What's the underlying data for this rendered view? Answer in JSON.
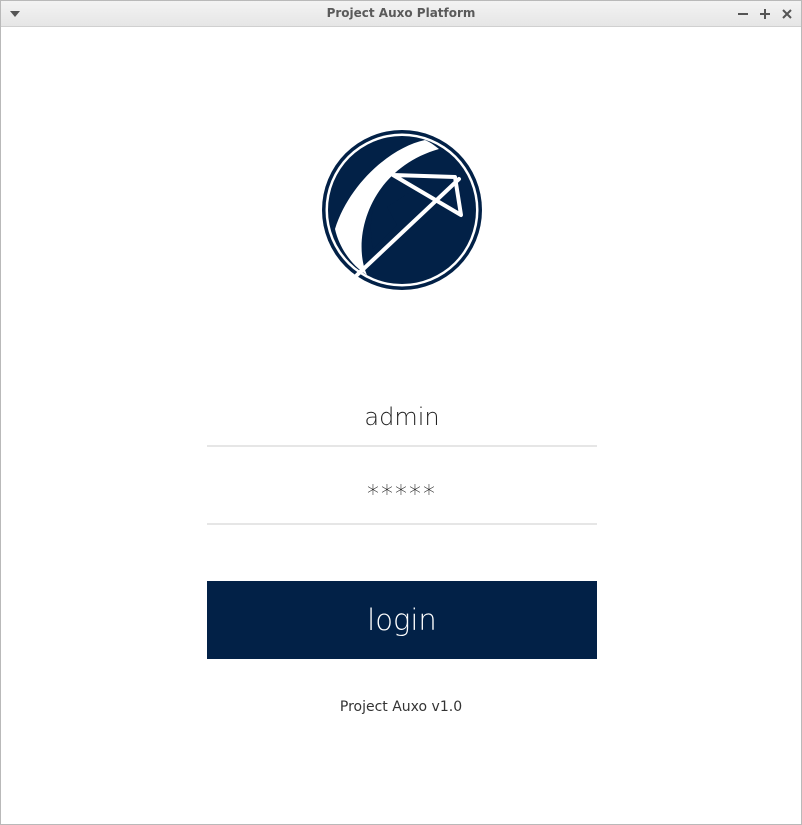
{
  "window": {
    "title": "Project Auxo Platform",
    "controls": {
      "menu_icon": "chevron-down-icon",
      "minimize_icon": "minus-icon",
      "maximize_icon": "plus-icon",
      "close_icon": "close-icon"
    }
  },
  "logo": {
    "icon": "project-auxo-logo",
    "color": "#022147"
  },
  "form": {
    "username_value": "admin",
    "password_value": "*****",
    "login_label": "login"
  },
  "footer": {
    "version_text": "Project Auxo v1.0"
  },
  "colors": {
    "accent": "#022147",
    "field_underline": "#e6e6e6"
  }
}
